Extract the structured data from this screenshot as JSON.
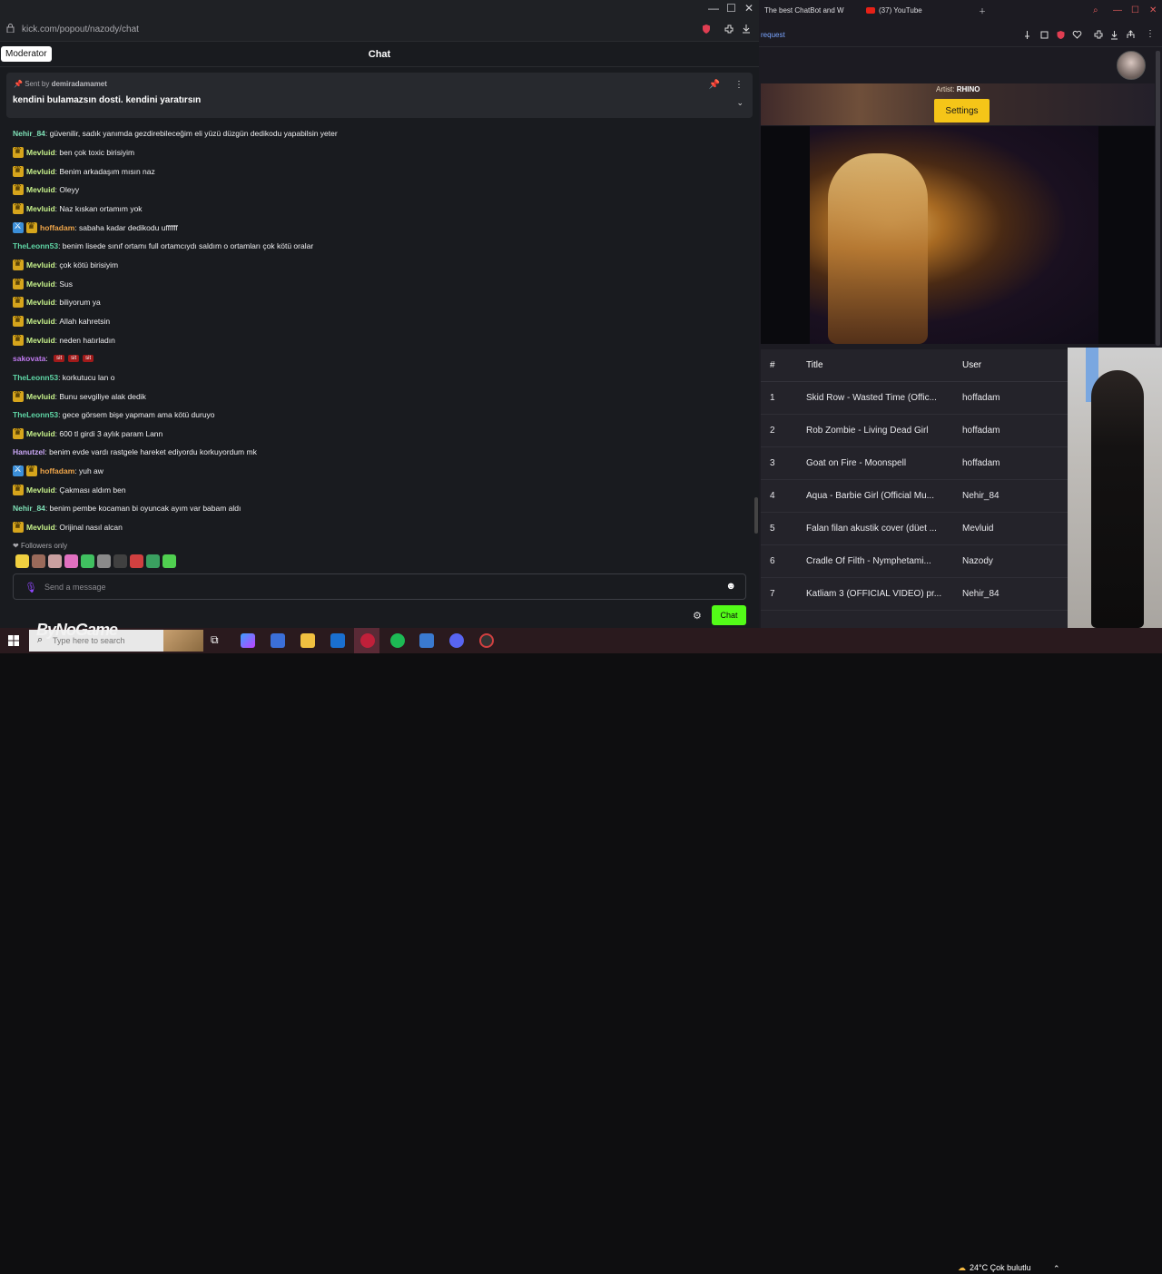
{
  "left_window": {
    "url": "kick.com/popout/nazody/chat",
    "tooltip": "Moderator",
    "header_title": "Chat",
    "pinned": {
      "sent_by_prefix": "Sent by",
      "sent_by_user": "demiradamamet",
      "message": "kendini bulamazsın dosti. kendini yaratırsın"
    },
    "messages": [
      {
        "badges": [],
        "user": "Nehir_84",
        "color": "#7ee0b6",
        "text": "güvenilir, sadık yanımda gezdirebileceğim eli yüzü düzgün dedikodu yapabilsin yeter"
      },
      {
        "badges": [
          "crown"
        ],
        "user": "Mevluid",
        "color": "#c6f08a",
        "text": "ben çok toxic birisiyim"
      },
      {
        "badges": [
          "crown"
        ],
        "user": "Mevluid",
        "color": "#c6f08a",
        "text": "Benim arkadaşım mısın naz"
      },
      {
        "badges": [
          "crown"
        ],
        "user": "Mevluid",
        "color": "#c6f08a",
        "text": "Oleyy"
      },
      {
        "badges": [
          "crown"
        ],
        "user": "Mevluid",
        "color": "#c6f08a",
        "text": "Naz kıskan ortamım yok"
      },
      {
        "badges": [
          "mod",
          "crown"
        ],
        "user": "hoffadam",
        "color": "#f0a64a",
        "text": "sabaha kadar dedikodu uffffff"
      },
      {
        "badges": [],
        "user": "TheLeonn53",
        "color": "#5fd6a6",
        "text": "benim lisede sınıf ortamı full ortamcıydı saldım o ortamları çok kötü oralar"
      },
      {
        "badges": [
          "crown"
        ],
        "user": "Mevluid",
        "color": "#c6f08a",
        "text": "çok kötü birisiyim"
      },
      {
        "badges": [
          "crown"
        ],
        "user": "Mevluid",
        "color": "#c6f08a",
        "text": "Sus"
      },
      {
        "badges": [
          "crown"
        ],
        "user": "Mevluid",
        "color": "#c6f08a",
        "text": "biliyorum ya"
      },
      {
        "badges": [
          "crown"
        ],
        "user": "Mevluid",
        "color": "#c6f08a",
        "text": "Allah kahretsin"
      },
      {
        "badges": [
          "crown"
        ],
        "user": "Mevluid",
        "color": "#c6f08a",
        "text": "neden hatırladın"
      },
      {
        "badges": [],
        "user": "sakovata",
        "color": "#c07af0",
        "text": "",
        "emotes": [
          "sit",
          "sit",
          "sit"
        ]
      },
      {
        "badges": [],
        "user": "TheLeonn53",
        "color": "#5fd6a6",
        "text": "korkutucu lan o"
      },
      {
        "badges": [
          "crown"
        ],
        "user": "Mevluid",
        "color": "#c6f08a",
        "text": "Bunu sevgiliye alak dedik"
      },
      {
        "badges": [],
        "user": "TheLeonn53",
        "color": "#5fd6a6",
        "text": "gece görsem bişe yapmam ama kötü duruyo"
      },
      {
        "badges": [
          "crown"
        ],
        "user": "Mevluid",
        "color": "#c6f08a",
        "text": "600 tl girdi 3 aylık param Lann"
      },
      {
        "badges": [],
        "user": "Hanutzel",
        "color": "#c9a6f5",
        "text": "benim evde vardı rastgele hareket ediyordu korkuyordum mk"
      },
      {
        "badges": [
          "mod",
          "crown"
        ],
        "user": "hoffadam",
        "color": "#f0a64a",
        "text": "yuh aw"
      },
      {
        "badges": [
          "crown"
        ],
        "user": "Mevluid",
        "color": "#c6f08a",
        "text": "Çakması aldım ben"
      },
      {
        "badges": [],
        "user": "Nehir_84",
        "color": "#7ee0b6",
        "text": "benim pembe kocaman bi oyuncak ayım var babam aldı"
      },
      {
        "badges": [
          "crown"
        ],
        "user": "Mevluid",
        "color": "#c6f08a",
        "text": "Orijinal nasıl alcan"
      }
    ],
    "followers_only": "Followers only",
    "input_placeholder": "Send a message",
    "chat_button": "Chat"
  },
  "right_window": {
    "tabs": [
      "The best ChatBot and W",
      "(37) YouTube"
    ],
    "url": "request",
    "artist_label": "Artist:",
    "artist_name": "RHINO",
    "settings_button": "Settings",
    "queue": {
      "headers": [
        "#",
        "Title",
        "User"
      ],
      "rows": [
        {
          "num": "1",
          "title": "Skid Row - Wasted Time (Offic...",
          "user": "hoffadam"
        },
        {
          "num": "2",
          "title": "Rob Zombie - Living Dead Girl",
          "user": "hoffadam"
        },
        {
          "num": "3",
          "title": "Goat on Fire - Moonspell",
          "user": "hoffadam"
        },
        {
          "num": "4",
          "title": "Aqua - Barbie Girl (Official Mu...",
          "user": "Nehir_84"
        },
        {
          "num": "5",
          "title": "Falan filan akustik cover (düet ...",
          "user": "Mevluid"
        },
        {
          "num": "6",
          "title": "Cradle Of Filth - Nymphetami...",
          "user": "Nazody"
        },
        {
          "num": "7",
          "title": "Katliam 3 (OFFICIAL VIDEO) pr...",
          "user": "Nehir_84"
        }
      ]
    }
  },
  "taskbar": {
    "search_placeholder": "Type here to search",
    "overlay_logo": "ByNoGame",
    "weather": "24°C  Çok bulutlu"
  }
}
